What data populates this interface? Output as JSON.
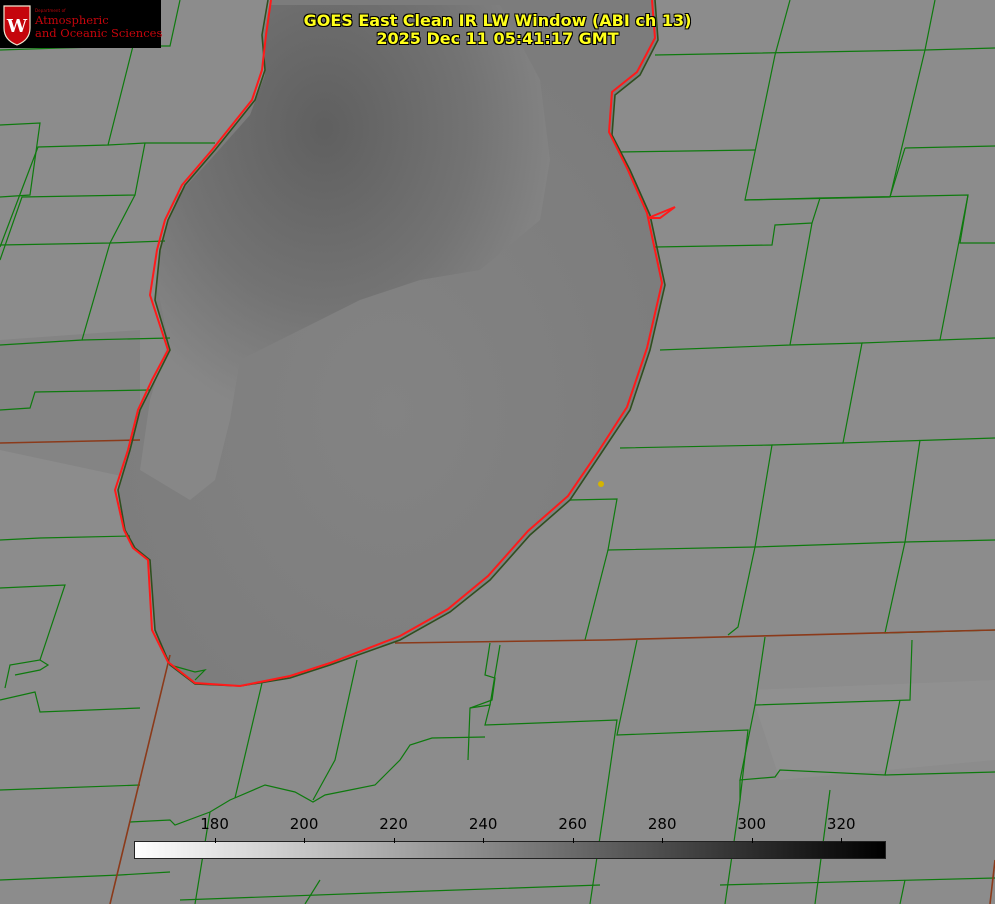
{
  "logo": {
    "crest_letter": "W",
    "line0": "Department of",
    "line1": "Atmospheric",
    "line2": "and Oceanic Sciences",
    "color": "#c5050c"
  },
  "title": {
    "line1": "GOES East Clean IR LW Window (ABI ch 13)",
    "line2": "2025 Dec 11 05:41:17 GMT",
    "color": "#ffff1a"
  },
  "colorbar": {
    "ticks": [
      "180",
      "200",
      "220",
      "240",
      "260",
      "280",
      "300",
      "320"
    ],
    "tick_values": [
      180,
      200,
      220,
      240,
      260,
      280,
      300,
      320
    ],
    "range": [
      162,
      330
    ],
    "gradient": [
      "#ffffff",
      "#000000"
    ]
  },
  "map_colors": {
    "county_lines": "#0e7a0e",
    "state_lines": "#8b3a1a",
    "shoreline": "#ff1a1a",
    "marker": "#d4b400"
  }
}
